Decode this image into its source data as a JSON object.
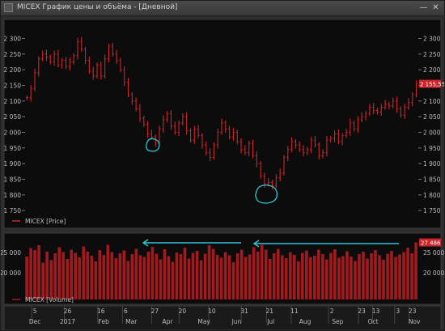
{
  "window": {
    "title": "MICEX График цены и объёма - [Дневной]",
    "minimize_icon": "minimize-icon",
    "close_icon": "close-icon"
  },
  "colors": {
    "background": "#0c0c0c",
    "price_series": "#c8262b",
    "price_label_bg": "#c8262b",
    "volume_bars": "#a11a1e",
    "annotation": "#2fc4d3",
    "gridlines": "#2a2a2a",
    "axis_text": "#bdbdbd"
  },
  "chart_data": [
    {
      "type": "line",
      "render": "ohlc-bars",
      "legend": "MICEX [Price]",
      "y_ticks": [
        "2 300",
        "2 250",
        "2 200",
        "2 150",
        "2 100",
        "2 050",
        "2 000",
        "1 950",
        "1 900",
        "1 850",
        "1 800",
        "1 750"
      ],
      "ylim": [
        1735,
        2340
      ],
      "last_value_label": "2 155,55",
      "grid": false,
      "values": [
        2110,
        2140,
        2190,
        2235,
        2250,
        2240,
        2225,
        2250,
        2215,
        2230,
        2210,
        2225,
        2245,
        2290,
        2265,
        2230,
        2195,
        2180,
        2215,
        2180,
        2235,
        2275,
        2250,
        2230,
        2200,
        2160,
        2120,
        2100,
        2075,
        2045,
        2025,
        1995,
        1985,
        1965,
        2010,
        2040,
        2060,
        2020,
        2000,
        2030,
        2050,
        2005,
        1975,
        2010,
        1990,
        1960,
        1935,
        1920,
        1960,
        2000,
        2030,
        2010,
        1985,
        2000,
        1970,
        1945,
        1935,
        1965,
        1925,
        1900,
        1860,
        1835,
        1840,
        1830,
        1855,
        1870,
        1920,
        1945,
        1970,
        1960,
        1945,
        1935,
        1945,
        1975,
        1960,
        1925,
        1935,
        1975,
        1980,
        1995,
        1970,
        1990,
        2000,
        2030,
        2010,
        2040,
        2050,
        2060,
        2080,
        2070,
        2065,
        2080,
        2090,
        2085,
        2100,
        2075,
        2055,
        2080,
        2095,
        2120,
        2155
      ]
    },
    {
      "type": "bar",
      "legend": "MICEX [Volume]",
      "y_ticks": [
        "25 000",
        "20 000"
      ],
      "ylim": [
        15000,
        29000
      ],
      "last_value_label": "27 486",
      "grid": false,
      "values": [
        24000,
        26100,
        25600,
        26800,
        22500,
        25200,
        23100,
        24800,
        26300,
        25100,
        23400,
        25700,
        24900,
        23800,
        26500,
        25200,
        24200,
        22800,
        25600,
        24400,
        26900,
        25100,
        23600,
        24800,
        25500,
        22900,
        24600,
        25900,
        24300,
        23900,
        25200,
        26400,
        24700,
        23300,
        25800,
        24100,
        22700,
        25000,
        24600,
        26200,
        23500,
        24900,
        25400,
        23100,
        24700,
        26800,
        25900,
        24400,
        23700,
        25100,
        24300,
        22600,
        24800,
        25700,
        23900,
        24500,
        26300,
        25200,
        26900,
        25700,
        23400,
        24800,
        25900,
        24300,
        23600,
        25100,
        24400,
        22800,
        24900,
        25500,
        23800,
        24200,
        25700,
        24600,
        23300,
        24900,
        25800,
        23700,
        24100,
        25300,
        24000,
        22900,
        24600,
        25200,
        23500,
        24800,
        25600,
        24300,
        23200,
        24700,
        25400,
        23900,
        24500,
        25100,
        26200,
        24800,
        27486
      ]
    }
  ],
  "x_axis": {
    "day_labels": [
      "5",
      "26",
      "16",
      "6",
      "27",
      "20",
      "10",
      "31",
      "21",
      "11",
      "2",
      "23",
      "13",
      "3",
      "23"
    ],
    "month_labels": [
      "Dec",
      "2017",
      "Feb",
      "Mar",
      "Apr",
      "May",
      "Jun",
      "Jul",
      "Aug",
      "Sep",
      "Oct",
      "Nov"
    ]
  },
  "annotations": {
    "circles": [
      "circle-mark-march-low",
      "circle-mark-june-low"
    ],
    "arrows": [
      "arrow-volume-left-1",
      "arrow-volume-left-2"
    ]
  }
}
